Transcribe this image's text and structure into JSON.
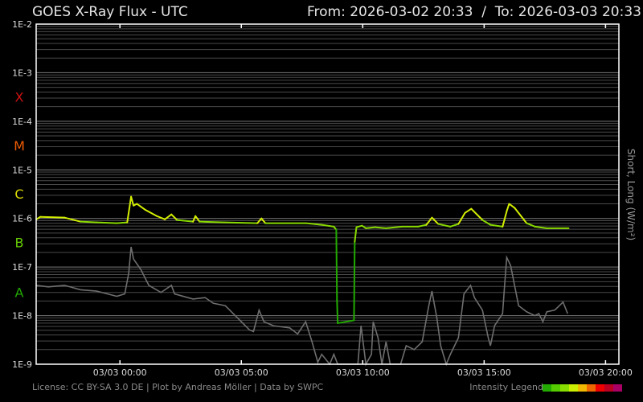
{
  "chart_data": {
    "type": "line",
    "title": "GOES X-Ray Flux - UTC",
    "range_label": "From: 2026-03-02 20:33  /  To: 2026-03-03 20:33",
    "ylabel": "Short, Long (W/m²)",
    "yscale": "log",
    "ylim": [
      1e-09,
      0.01
    ],
    "xlim_hours_rel_0303": [
      -3.45,
      20.55
    ],
    "y_ticks": [
      {
        "label": "1E-2",
        "value": 0.01
      },
      {
        "label": "1E-3",
        "value": 0.001
      },
      {
        "label": "1E-4",
        "value": 0.0001
      },
      {
        "label": "1E-5",
        "value": 1e-05
      },
      {
        "label": "1E-6",
        "value": 1e-06
      },
      {
        "label": "1E-7",
        "value": 1e-07
      },
      {
        "label": "1E-8",
        "value": 1e-08
      },
      {
        "label": "1E-9",
        "value": 1e-09
      }
    ],
    "x_ticks": [
      {
        "label": "03/03 00:00",
        "hour": 0
      },
      {
        "label": "03/03 05:00",
        "hour": 5
      },
      {
        "label": "03/03 10:00",
        "hour": 10
      },
      {
        "label": "03/03 15:00",
        "hour": 15
      },
      {
        "label": "03/03 20:00",
        "hour": 20
      }
    ],
    "classes": [
      {
        "label": "X",
        "value": 0.00032,
        "color": "#cc1111"
      },
      {
        "label": "M",
        "value": 3.2e-05,
        "color": "#ee5a00"
      },
      {
        "label": "C",
        "value": 3.2e-06,
        "color": "#dddd00"
      },
      {
        "label": "B",
        "value": 3.2e-07,
        "color": "#66cc00"
      },
      {
        "label": "A",
        "value": 3e-08,
        "color": "#22aa00"
      }
    ],
    "grid": true,
    "series": [
      {
        "name": "Long",
        "points": [
          [
            -3.44,
            9.6e-07
          ],
          [
            -3.28,
            1.08e-06
          ],
          [
            -2.28,
            1.04e-06
          ],
          [
            -1.62,
            8.6e-07
          ],
          [
            -0.96,
            8.3e-07
          ],
          [
            -0.13,
            8e-07
          ],
          [
            0.3,
            8.3e-07
          ],
          [
            0.46,
            2.8e-06
          ],
          [
            0.56,
            1.84e-06
          ],
          [
            0.7,
            2e-06
          ],
          [
            1.03,
            1.52e-06
          ],
          [
            1.52,
            1.12e-06
          ],
          [
            1.85,
            9.6e-07
          ],
          [
            2.12,
            1.21e-06
          ],
          [
            2.35,
            9.3e-07
          ],
          [
            3.01,
            8.6e-07
          ],
          [
            3.11,
            1.12e-06
          ],
          [
            3.28,
            8.6e-07
          ],
          [
            4.34,
            8.3e-07
          ],
          [
            5.66,
            8e-07
          ],
          [
            5.83,
            1e-06
          ],
          [
            5.99,
            8e-07
          ],
          [
            7.65,
            8e-07
          ],
          [
            8.31,
            7.4e-07
          ],
          [
            8.81,
            6.8e-07
          ],
          [
            8.91,
            5.9e-07
          ],
          [
            8.94,
            2.1e-08
          ],
          [
            8.97,
            7e-09
          ],
          [
            9.64,
            8e-09
          ],
          [
            9.67,
            3.3e-07
          ],
          [
            9.74,
            6.6e-07
          ],
          [
            9.97,
            7.1e-07
          ],
          [
            10.13,
            6.3e-07
          ],
          [
            10.5,
            6.6e-07
          ],
          [
            10.96,
            6.3e-07
          ],
          [
            11.62,
            6.8e-07
          ],
          [
            12.28,
            6.8e-07
          ],
          [
            12.62,
            7.4e-07
          ],
          [
            12.85,
            1.04e-06
          ],
          [
            13.11,
            7.7e-07
          ],
          [
            13.61,
            6.8e-07
          ],
          [
            13.94,
            7.7e-07
          ],
          [
            14.21,
            1.3e-06
          ],
          [
            14.47,
            1.58e-06
          ],
          [
            14.93,
            9.3e-07
          ],
          [
            15.26,
            7.4e-07
          ],
          [
            15.76,
            6.8e-07
          ],
          [
            15.93,
            1.41e-06
          ],
          [
            16.03,
            2e-06
          ],
          [
            16.26,
            1.64e-06
          ],
          [
            16.75,
            8e-07
          ],
          [
            17.09,
            6.8e-07
          ],
          [
            17.58,
            6.3e-07
          ],
          [
            18.25,
            6.3e-07
          ],
          [
            18.48,
            6.3e-07
          ]
        ]
      },
      {
        "name": "Short",
        "color": "#6e6e6e",
        "points": [
          [
            -3.44,
            4.2e-08
          ],
          [
            -2.95,
            3.9e-08
          ],
          [
            -2.28,
            4.2e-08
          ],
          [
            -1.62,
            3.4e-08
          ],
          [
            -0.96,
            3.2e-08
          ],
          [
            -0.13,
            2.5e-08
          ],
          [
            0.2,
            2.8e-08
          ],
          [
            0.36,
            7.4e-08
          ],
          [
            0.46,
            2.6e-07
          ],
          [
            0.56,
            1.46e-07
          ],
          [
            0.86,
            8.9e-08
          ],
          [
            1.19,
            4.2e-08
          ],
          [
            1.69,
            3e-08
          ],
          [
            2.12,
            4.2e-08
          ],
          [
            2.25,
            2.8e-08
          ],
          [
            3.01,
            2.2e-08
          ],
          [
            3.51,
            2.35e-08
          ],
          [
            3.84,
            1.8e-08
          ],
          [
            4.34,
            1.6e-08
          ],
          [
            5.0,
            7.5e-09
          ],
          [
            5.33,
            5.1e-09
          ],
          [
            5.5,
            4.7e-09
          ],
          [
            5.73,
            1.3e-08
          ],
          [
            5.93,
            7.5e-09
          ],
          [
            6.32,
            6.2e-09
          ],
          [
            6.99,
            5.6e-09
          ],
          [
            7.32,
            4.2e-09
          ],
          [
            7.65,
            7.5e-09
          ],
          [
            7.81,
            4.2e-09
          ],
          [
            7.91,
            2.9e-09
          ],
          [
            8.15,
            1.1e-09
          ],
          [
            8.31,
            1.6e-09
          ],
          [
            8.64,
            1e-09
          ],
          [
            8.81,
            1.6e-09
          ],
          [
            8.97,
            1e-09
          ],
          [
            9.8,
            1e-09
          ],
          [
            9.93,
            6.2e-09
          ],
          [
            10.13,
            1e-09
          ],
          [
            10.36,
            1.6e-09
          ],
          [
            10.43,
            7.5e-09
          ],
          [
            10.63,
            3.5e-09
          ],
          [
            10.79,
            1e-09
          ],
          [
            10.96,
            2.9e-09
          ],
          [
            11.13,
            1e-09
          ],
          [
            11.56,
            1e-09
          ],
          [
            11.79,
            2.4e-09
          ],
          [
            12.12,
            2e-09
          ],
          [
            12.45,
            2.9e-09
          ],
          [
            12.72,
            1.6e-08
          ],
          [
            12.85,
            3.2e-08
          ],
          [
            13.05,
            9.1e-09
          ],
          [
            13.21,
            2.4e-09
          ],
          [
            13.44,
            1e-09
          ],
          [
            13.61,
            1.6e-09
          ],
          [
            13.94,
            3.5e-09
          ],
          [
            14.17,
            2.8e-08
          ],
          [
            14.44,
            4.2e-08
          ],
          [
            14.6,
            2.35e-08
          ],
          [
            14.93,
            1.3e-08
          ],
          [
            15.17,
            3.5e-09
          ],
          [
            15.26,
            2.4e-09
          ],
          [
            15.43,
            6.2e-09
          ],
          [
            15.76,
            1.1e-08
          ],
          [
            15.83,
            3.4e-08
          ],
          [
            15.93,
            1.58e-07
          ],
          [
            16.09,
            1.08e-07
          ],
          [
            16.42,
            1.6e-08
          ],
          [
            16.75,
            1.2e-08
          ],
          [
            17.09,
            1e-08
          ],
          [
            17.25,
            1.1e-08
          ],
          [
            17.42,
            7.5e-09
          ],
          [
            17.58,
            1.2e-08
          ],
          [
            17.91,
            1.3e-08
          ],
          [
            18.25,
            1.9e-08
          ],
          [
            18.44,
            1.1e-08
          ]
        ]
      }
    ],
    "long_level_colors": {
      "c": "#d4ee00",
      "b": "#88d800",
      "a": "#22aa00"
    },
    "footer": "License: CC BY-SA 3.0 DE | Plot by Andreas Möller | Data by SWPC",
    "legend": {
      "label": "Intensity Legend",
      "colors": [
        "#22aa00",
        "#55cc00",
        "#88dd00",
        "#ccee00",
        "#f0b800",
        "#ee6600",
        "#ee0000",
        "#bb0022",
        "#aa0066"
      ]
    }
  }
}
